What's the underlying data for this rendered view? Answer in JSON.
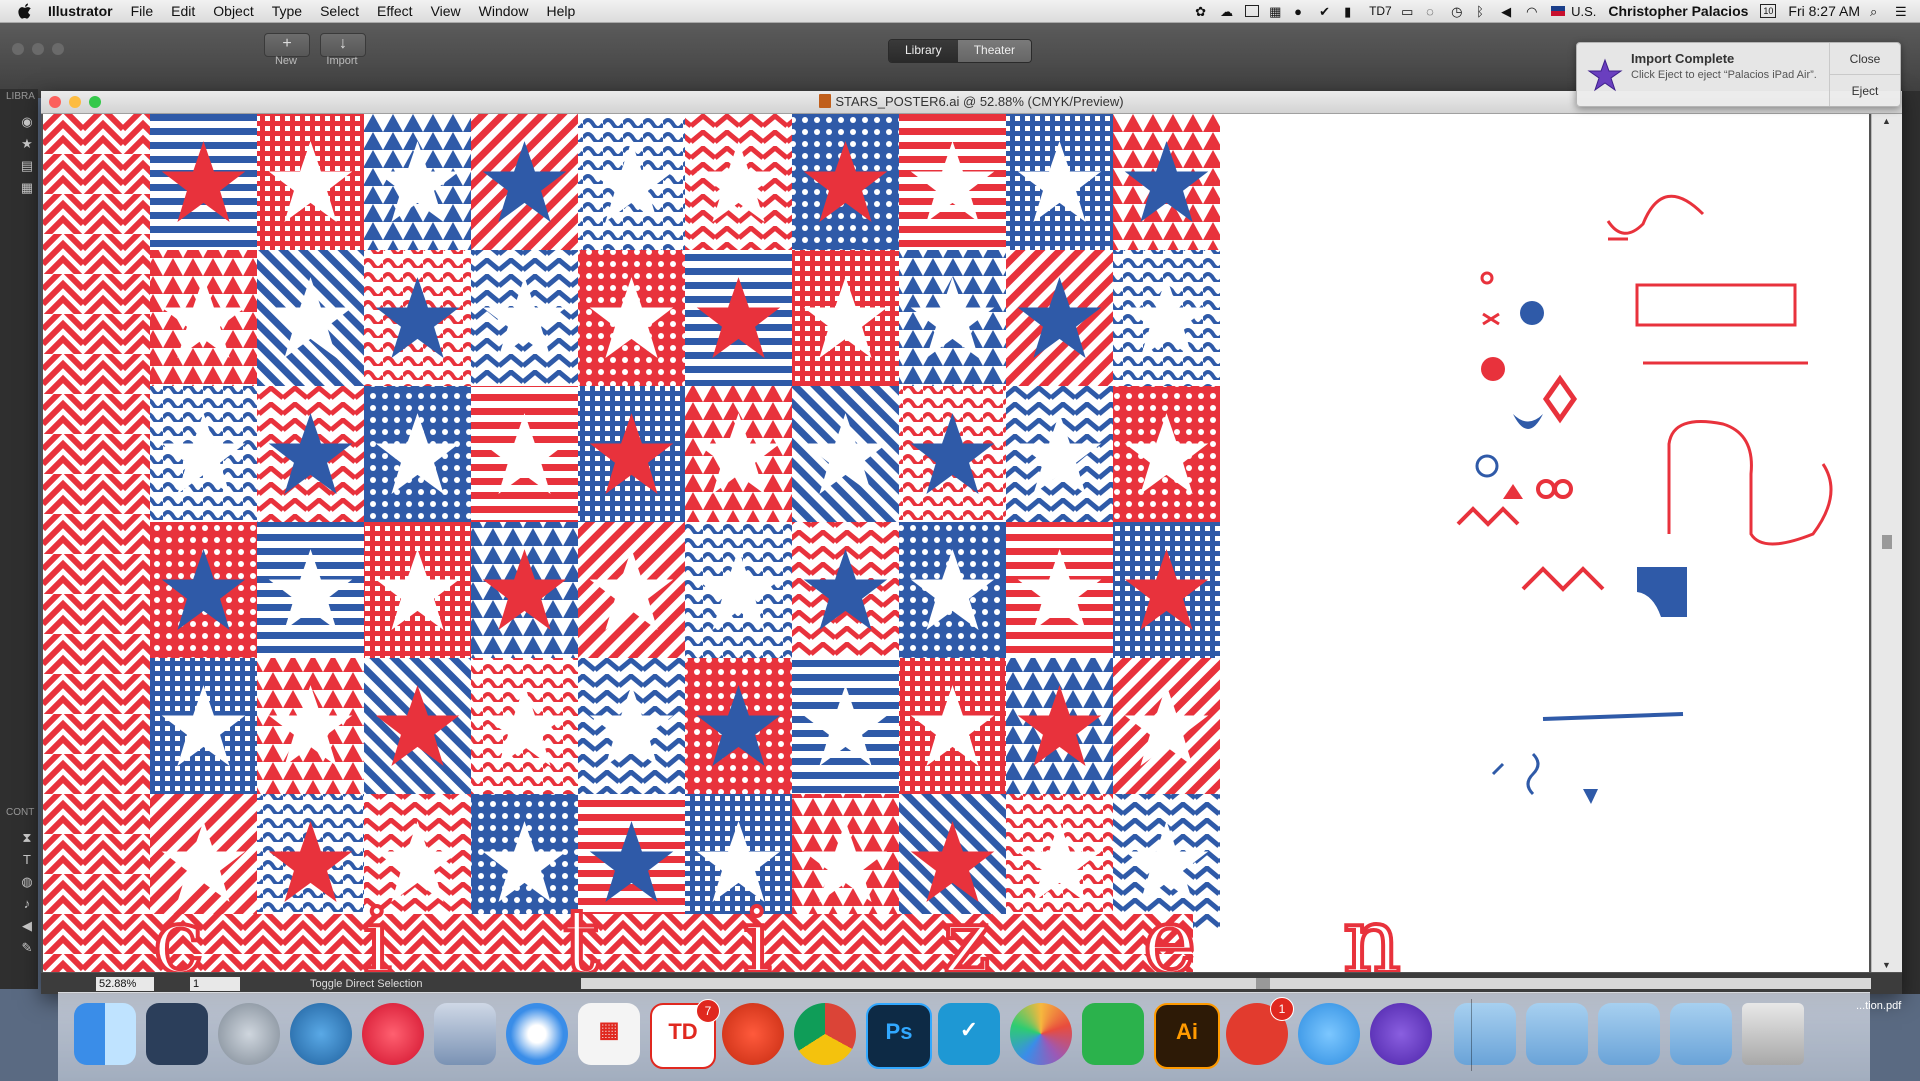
{
  "menubar": {
    "app_name": "Illustrator",
    "items": [
      "File",
      "Edit",
      "Object",
      "Type",
      "Select",
      "Effect",
      "View",
      "Window",
      "Help"
    ],
    "locale": "U.S.",
    "user": "Christopher Palacios",
    "calendar_day": "10",
    "clock": "Fri 8:27 AM"
  },
  "background_window": {
    "toolbar_labels": [
      "New",
      "Import"
    ],
    "segments": [
      "Library",
      "Theater"
    ],
    "active_segment": "Library"
  },
  "notification": {
    "title": "Import Complete",
    "text": "Click Eject to eject “Palacios iPad Air”.",
    "actions": [
      "Close",
      "Eject"
    ]
  },
  "left_panel": {
    "labels": [
      "LIBRA",
      "CONT"
    ]
  },
  "document": {
    "title": "STARS_POSTER6.ai @ 52.88% (CMYK/Preview)",
    "zoom": "52.88%",
    "page": "1",
    "status_text": "Toggle Direct Selection",
    "poster_letters": [
      "c",
      "i",
      "t",
      "i",
      "z",
      "e",
      "n"
    ]
  },
  "colors": {
    "red": "#e8323c",
    "blue": "#2f5aa8",
    "white": "#ffffff"
  },
  "dock": {
    "file_label": "...tion.pdf",
    "apps": [
      {
        "name": "finder-icon",
        "badge": ""
      },
      {
        "name": "mission-control-icon",
        "badge": ""
      },
      {
        "name": "launchpad-icon",
        "badge": ""
      },
      {
        "name": "tweetbot-icon",
        "badge": ""
      },
      {
        "name": "itunes-icon",
        "badge": ""
      },
      {
        "name": "preview-icon",
        "badge": ""
      },
      {
        "name": "safari-icon",
        "badge": ""
      },
      {
        "name": "app-grid-icon",
        "badge": ""
      },
      {
        "name": "todoist-icon",
        "badge": "7"
      },
      {
        "name": "tomato-icon",
        "badge": ""
      },
      {
        "name": "chrome-icon",
        "badge": ""
      },
      {
        "name": "photoshop-icon",
        "badge": ""
      },
      {
        "name": "checkmark-app-icon",
        "badge": ""
      },
      {
        "name": "photos-icon",
        "badge": ""
      },
      {
        "name": "feedly-icon",
        "badge": ""
      },
      {
        "name": "illustrator-icon",
        "badge": ""
      },
      {
        "name": "wunderlist-icon",
        "badge": "1"
      },
      {
        "name": "messages-icon",
        "badge": ""
      },
      {
        "name": "imovie-icon",
        "badge": ""
      },
      {
        "name": "home-folder-icon",
        "badge": ""
      },
      {
        "name": "downloads-folder-icon",
        "badge": ""
      },
      {
        "name": "folder-icon",
        "badge": ""
      },
      {
        "name": "documents-folder-icon",
        "badge": ""
      },
      {
        "name": "trash-icon",
        "badge": ""
      }
    ]
  }
}
